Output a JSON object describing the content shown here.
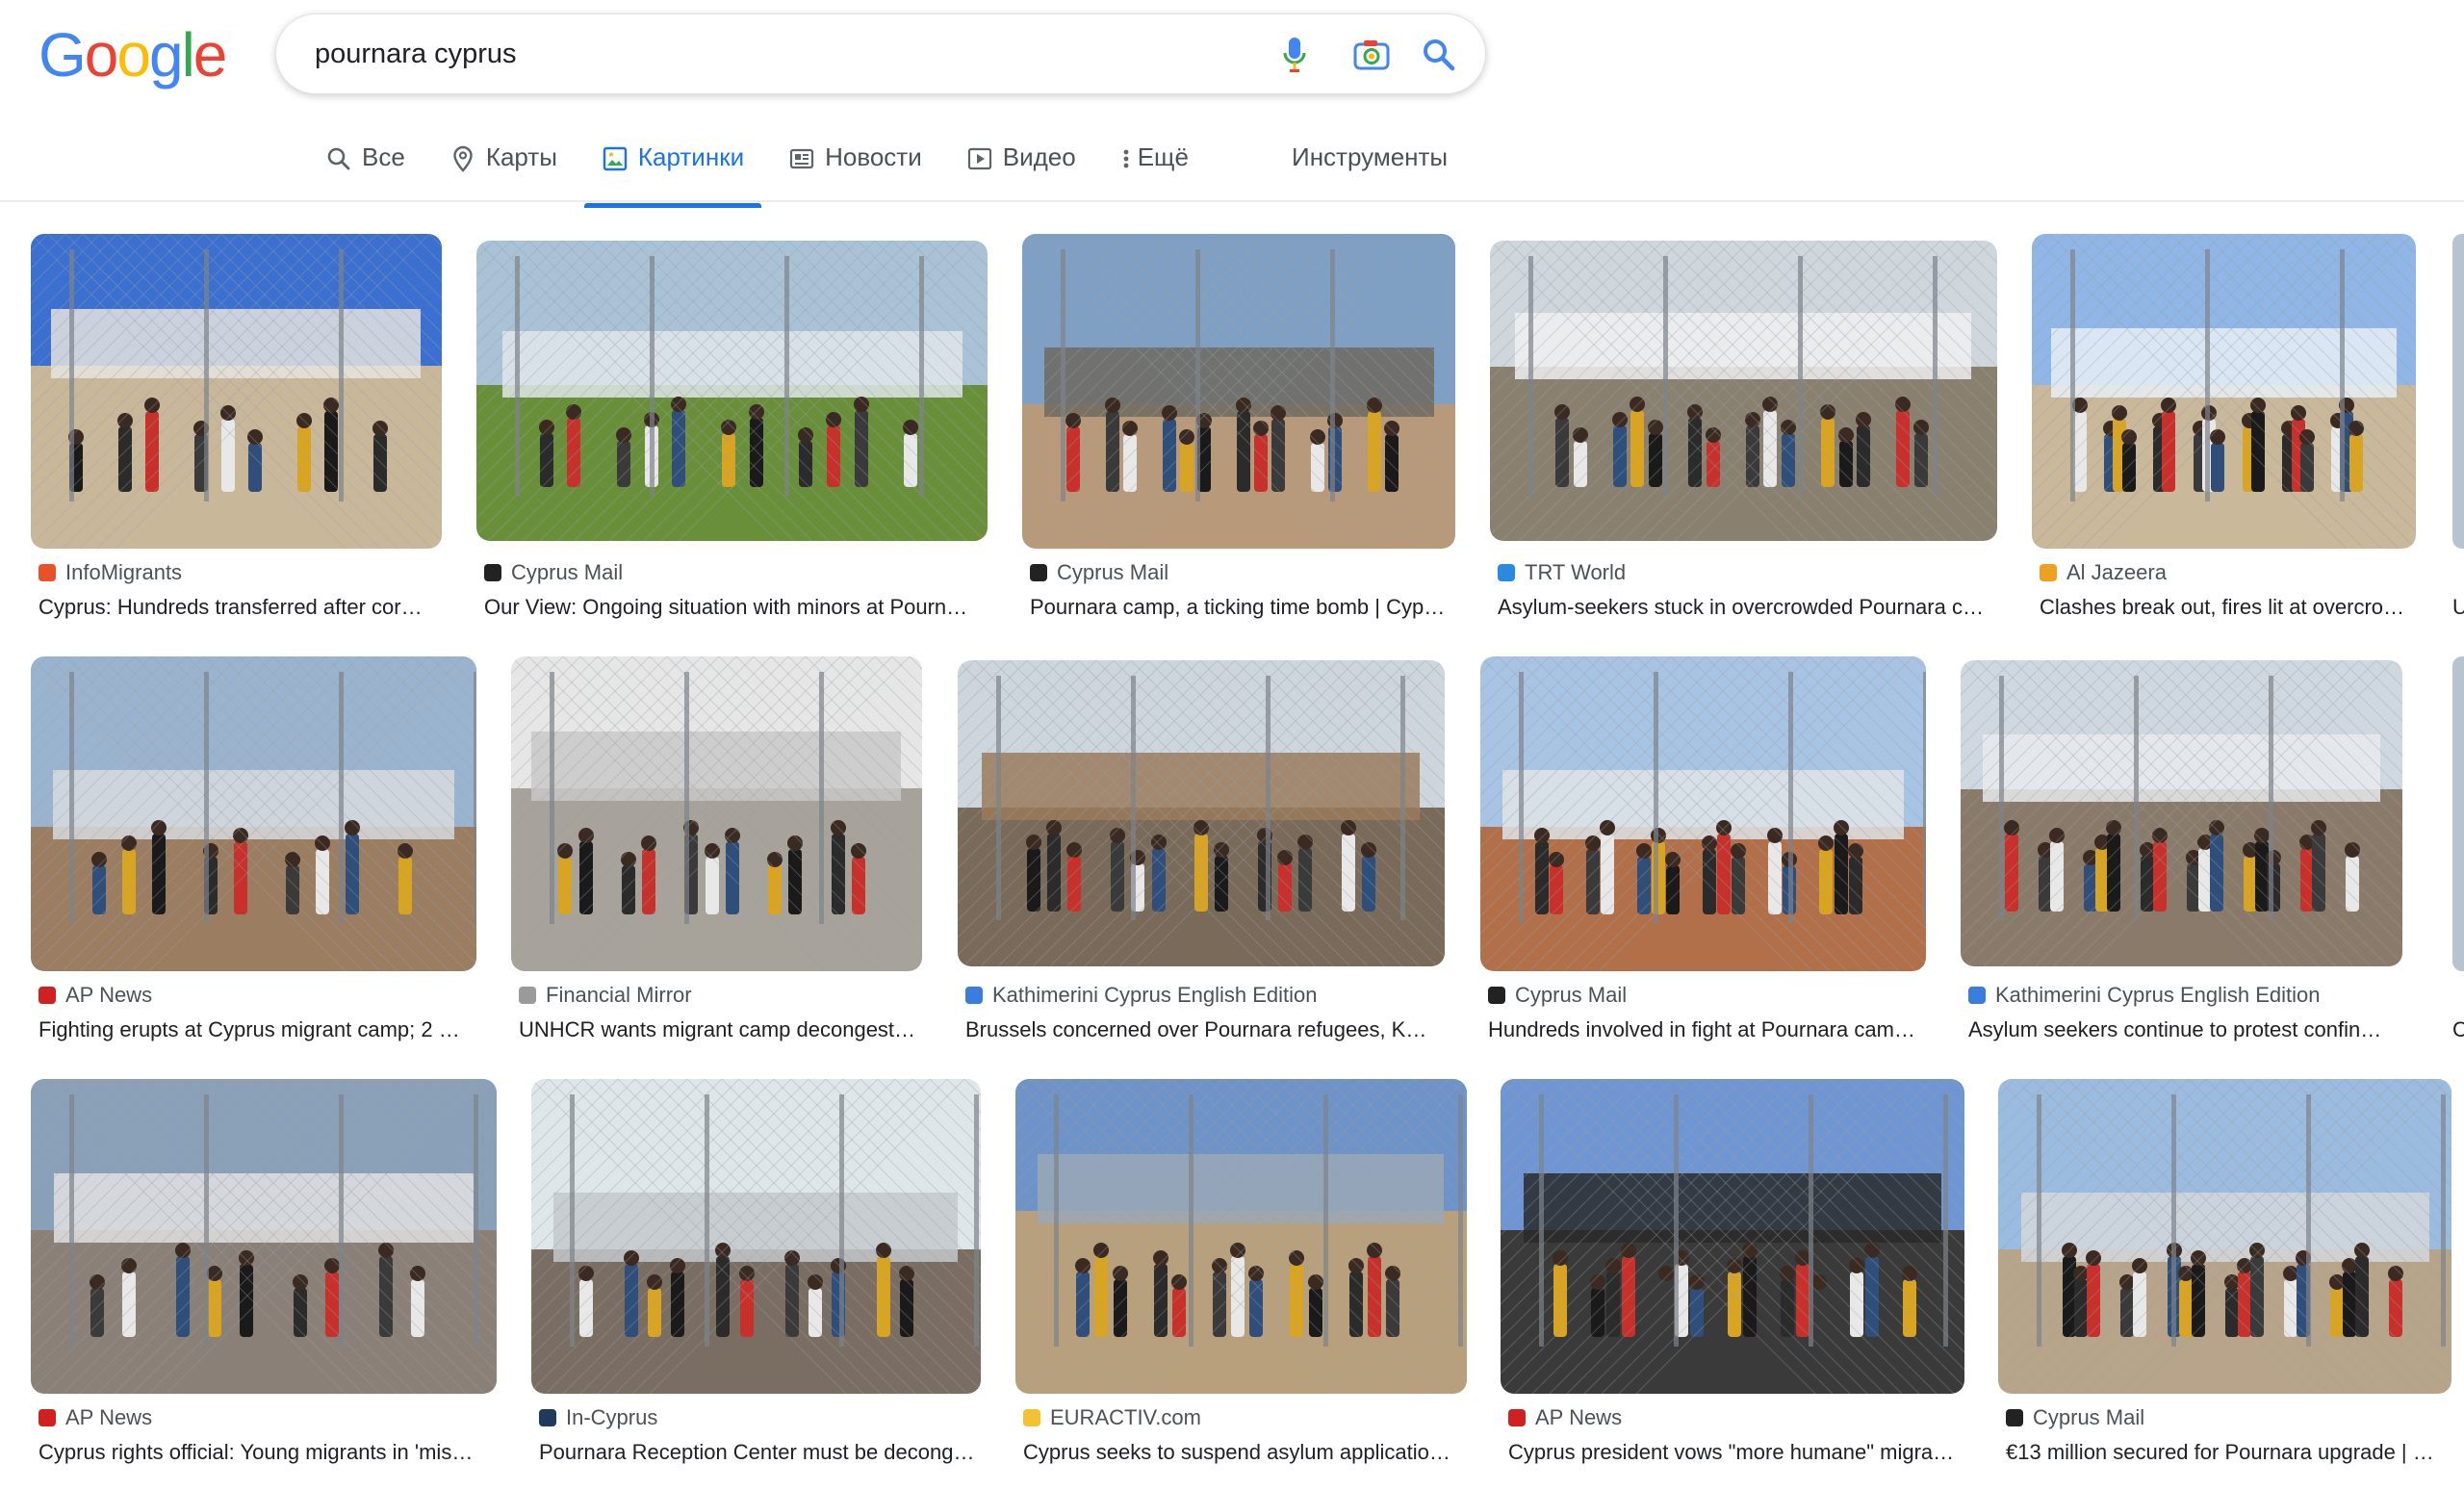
{
  "logo": {
    "letters": [
      {
        "ch": "G",
        "color": "#4285F4"
      },
      {
        "ch": "o",
        "color": "#EA4335"
      },
      {
        "ch": "o",
        "color": "#FBBC05"
      },
      {
        "ch": "g",
        "color": "#4285F4"
      },
      {
        "ch": "l",
        "color": "#34A853"
      },
      {
        "ch": "e",
        "color": "#EA4335"
      }
    ]
  },
  "search": {
    "query": "pournara cyprus"
  },
  "tabs": [
    {
      "label": "Все",
      "icon": "search-icon"
    },
    {
      "label": "Карты",
      "icon": "map-pin-icon"
    },
    {
      "label": "Картинки",
      "icon": "image-icon",
      "active": true
    },
    {
      "label": "Новости",
      "icon": "news-icon"
    },
    {
      "label": "Видео",
      "icon": "video-icon"
    },
    {
      "label": "Ещё",
      "icon": "more-vert-icon"
    }
  ],
  "tools_label": "Инструменты",
  "results": [
    {
      "source": "InfoMigrants",
      "title": "Cyprus: Hundreds transferred after cor…",
      "fav": "#e8522a",
      "scene": {
        "sky": "#3b6fd0",
        "ground": "#c9b79a",
        "mid": "#e6e4df"
      }
    },
    {
      "source": "Cyprus Mail",
      "title": "Our View: Ongoing situation with minors at Pourn…",
      "fav": "#222222",
      "scene": {
        "sky": "#a9c2d6",
        "ground": "#6a8f3a",
        "mid": "#dfe6ea"
      }
    },
    {
      "source": "Cyprus Mail",
      "title": "Pournara camp, a ticking time bomb | Cyp…",
      "fav": "#222222",
      "scene": {
        "sky": "#7fa0c4",
        "ground": "#b89a7a",
        "mid": "#6e6a62"
      }
    },
    {
      "source": "TRT World",
      "title": "Asylum-seekers stuck in overcrowded Pournara c…",
      "fav": "#2a8ae0",
      "scene": {
        "sky": "#cfd6dc",
        "ground": "#8a8070",
        "mid": "#f0f0f0"
      }
    },
    {
      "source": "Al Jazeera",
      "title": "Clashes break out, fires lit at overcro…",
      "fav": "#f0a020",
      "scene": {
        "sky": "#8fb6e6",
        "ground": "#c9b89a",
        "mid": "#e8eef5"
      }
    },
    {
      "source": "AP News",
      "title": "Fighting erupts at Cyprus migrant camp; 2 …",
      "fav": "#d02020",
      "scene": {
        "sky": "#9ab4d0",
        "ground": "#9b7d62",
        "mid": "#d8dbdf"
      }
    },
    {
      "source": "Financial Mirror",
      "title": "UNHCR wants migrant camp decongest…",
      "fav": "#9a9a9a",
      "scene": {
        "sky": "#e6e6e6",
        "ground": "#a7a29a",
        "mid": "#c8c8c8"
      }
    },
    {
      "source": "Kathimerini Cyprus English Edition",
      "title": "Brussels concerned over Pournara refugees, KN…",
      "fav": "#3a7de0",
      "scene": {
        "sky": "#cdd6dc",
        "ground": "#7a6a5a",
        "mid": "#9a7a5a"
      }
    },
    {
      "source": "Cyprus Mail",
      "title": "Hundreds involved in fight at Pournara cam…",
      "fav": "#222222",
      "scene": {
        "sky": "#a8c4e4",
        "ground": "#b1704a",
        "mid": "#dfe4e8"
      }
    },
    {
      "source": "Kathimerini Cyprus English Edition",
      "title": "Asylum seekers continue to protest confin…",
      "fav": "#3a7de0",
      "scene": {
        "sky": "#cfd8e0",
        "ground": "#8a7a6a",
        "mid": "#e8eaec"
      }
    },
    {
      "source": "AP News",
      "title": "Cyprus rights official: Young migrants in 'mis…",
      "fav": "#d02020",
      "scene": {
        "sky": "#8aa0b8",
        "ground": "#8a8078",
        "mid": "#e0e0e0"
      }
    },
    {
      "source": "In-Cyprus",
      "title": "Pournara Reception Center must be decong…",
      "fav": "#1f3a5a",
      "scene": {
        "sky": "#dfe6ea",
        "ground": "#7a6e62",
        "mid": "#c4c8cc"
      }
    },
    {
      "source": "EURACTIV.com",
      "title": "Cyprus seeks to suspend asylum applicatio…",
      "fav": "#f2c230",
      "scene": {
        "sky": "#6d93c8",
        "ground": "#b9a07c",
        "mid": "#9aa8b6"
      }
    },
    {
      "source": "AP News",
      "title": "Cyprus president vows \"more humane\" migra…",
      "fav": "#d02020",
      "scene": {
        "sky": "#6f96d2",
        "ground": "#3a3a3a",
        "mid": "#2a2a2a"
      }
    },
    {
      "source": "Cyprus Mail",
      "title": "€13 million secured for Pournara upgrade | …",
      "fav": "#222222",
      "scene": {
        "sky": "#9cbbe0",
        "ground": "#b8a48a",
        "mid": "#d4d8dc"
      }
    }
  ],
  "edge_titles": [
    "U",
    "Cl"
  ]
}
